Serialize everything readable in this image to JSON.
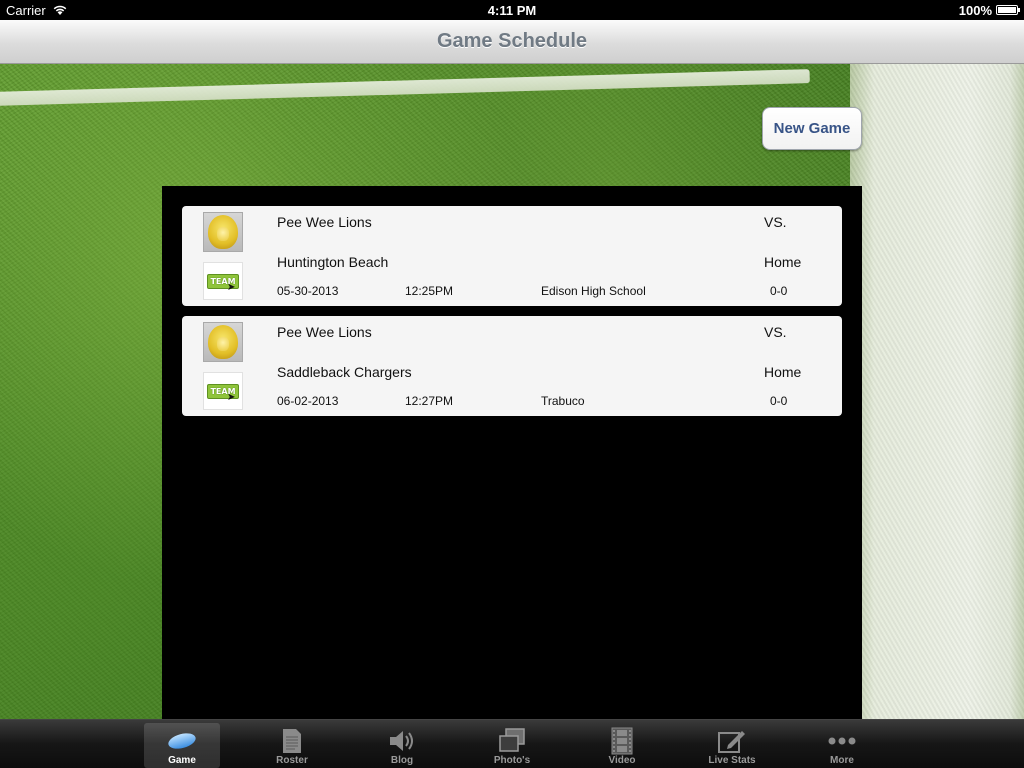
{
  "status_bar": {
    "carrier": "Carrier",
    "time": "4:11 PM",
    "battery": "100%"
  },
  "nav": {
    "title": "Game Schedule"
  },
  "actions": {
    "new_game": "New Game"
  },
  "games": [
    {
      "home_team": "Pee Wee  Lions",
      "vs": "VS.",
      "opponent": "Huntington Beach",
      "location_type": "Home",
      "date": "05-30-2013",
      "time": "12:25PM",
      "venue": "Edison High School",
      "score": "0-0",
      "team_badge": "TEAM"
    },
    {
      "home_team": "Pee Wee  Lions",
      "vs": "VS.",
      "opponent": "Saddleback Chargers",
      "location_type": "Home",
      "date": "06-02-2013",
      "time": "12:27PM",
      "venue": "Trabuco",
      "score": "0-0",
      "team_badge": "TEAM"
    }
  ],
  "tabs": [
    {
      "label": "Game",
      "icon": "football-icon",
      "selected": true
    },
    {
      "label": "Roster",
      "icon": "document-icon",
      "selected": false
    },
    {
      "label": "Blog",
      "icon": "speaker-icon",
      "selected": false
    },
    {
      "label": "Photo's",
      "icon": "photos-icon",
      "selected": false
    },
    {
      "label": "Video",
      "icon": "film-icon",
      "selected": false
    },
    {
      "label": "Live Stats",
      "icon": "edit-icon",
      "selected": false
    },
    {
      "label": "More",
      "icon": "more-icon",
      "selected": false
    }
  ]
}
